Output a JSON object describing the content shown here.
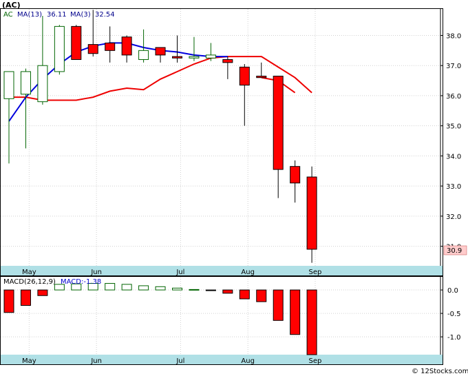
{
  "header": {
    "title": "(AC)",
    "legend_symbol": "AC",
    "ma13_label": "MA(13)",
    "ma13_value": "36.11",
    "ma3_label": "MA(3)",
    "ma3_value": "32.54",
    "macd_label": "MACD(26,12,9)",
    "macd_value_label": "MACD:-1.38"
  },
  "last_price_label": "30.9",
  "footer": {
    "credit": "© 12Stocks.com"
  },
  "colors": {
    "up": "#006400",
    "down": "#ff0000",
    "ma13": "#0000dd",
    "ma3": "#ee0000",
    "axis_band": "#b0e0e6",
    "price_tag": "#ffcccc"
  },
  "chart_data": [
    {
      "type": "candlestick",
      "x_ticks": [
        "May",
        "Jun",
        "Jul",
        "Aug",
        "Sep"
      ],
      "x_tick_index": [
        1.2,
        5.2,
        10.2,
        14.2,
        18.2
      ],
      "y_ticks": [
        31.0,
        32.0,
        33.0,
        34.0,
        35.0,
        36.0,
        37.0,
        38.0
      ],
      "y_tick_labels": [
        "31.0",
        "32.0",
        "33.0",
        "34.0",
        "35.0",
        "36.0",
        "37.0",
        "38.0"
      ],
      "ylim": [
        30.35,
        38.88
      ],
      "grid": true,
      "candles": [
        {
          "open": 35.9,
          "high": 36.5,
          "low": 33.75,
          "close": 36.8
        },
        {
          "open": 36.05,
          "high": 36.9,
          "low": 34.25,
          "close": 36.8
        },
        {
          "open": 35.8,
          "high": 38.65,
          "low": 35.7,
          "close": 37.0
        },
        {
          "open": 36.8,
          "high": 38.35,
          "low": 36.7,
          "close": 38.3
        },
        {
          "open": 38.3,
          "high": 38.35,
          "low": 37.2,
          "close": 37.2
        },
        {
          "open": 37.7,
          "high": 38.85,
          "low": 37.3,
          "close": 37.4
        },
        {
          "open": 37.75,
          "high": 38.3,
          "low": 37.1,
          "close": 37.5
        },
        {
          "open": 37.95,
          "high": 38.0,
          "low": 37.1,
          "close": 37.35
        },
        {
          "open": 37.2,
          "high": 38.2,
          "low": 37.1,
          "close": 37.5
        },
        {
          "open": 37.6,
          "high": 37.6,
          "low": 37.1,
          "close": 37.35
        },
        {
          "open": 37.3,
          "high": 38.0,
          "low": 37.1,
          "close": 37.25
        },
        {
          "open": 37.25,
          "high": 37.95,
          "low": 37.15,
          "close": 37.3
        },
        {
          "open": 37.25,
          "high": 37.75,
          "low": 37.15,
          "close": 37.35
        },
        {
          "open": 37.2,
          "high": 37.3,
          "low": 36.55,
          "close": 37.1
        },
        {
          "open": 36.95,
          "high": 37.05,
          "low": 35.0,
          "close": 36.35
        },
        {
          "open": 36.65,
          "high": 37.1,
          "low": 36.6,
          "close": 36.6
        },
        {
          "open": 36.65,
          "high": 36.65,
          "low": 32.6,
          "close": 33.55
        },
        {
          "open": 33.65,
          "high": 33.85,
          "low": 32.45,
          "close": 33.1
        },
        {
          "open": 33.3,
          "high": 33.65,
          "low": 30.45,
          "close": 30.9
        }
      ],
      "series": [
        {
          "name": "MA(13)",
          "values": [
            35.15,
            35.95,
            36.55,
            37.05,
            37.45,
            37.65,
            37.75,
            37.75,
            37.6,
            37.5,
            37.45,
            37.35,
            37.3,
            37.3,
            null,
            null,
            null,
            null,
            null
          ]
        },
        {
          "name": "MA(3)",
          "values": [
            35.95,
            35.95,
            35.85,
            35.85,
            35.85,
            35.95,
            36.15,
            36.25,
            36.2,
            36.55,
            36.8,
            37.05,
            37.25,
            37.3,
            37.3,
            37.3,
            36.95,
            36.6,
            36.1
          ]
        },
        {
          "name": "MA(3) late",
          "values": [
            null,
            null,
            null,
            null,
            null,
            null,
            null,
            null,
            null,
            null,
            null,
            null,
            null,
            null,
            null,
            36.6,
            36.5,
            36.1,
            null
          ]
        }
      ]
    },
    {
      "type": "bar",
      "title": "MACD(26,12,9)",
      "y_ticks": [
        0.0,
        -0.5,
        -1.0
      ],
      "y_tick_labels": [
        "0.0",
        "-0.5",
        "-1.0"
      ],
      "ylim": [
        -1.38,
        0.28
      ],
      "values": [
        -0.48,
        -0.33,
        -0.12,
        0.12,
        0.13,
        0.14,
        0.14,
        0.12,
        0.09,
        0.07,
        0.04,
        0.01,
        -0.01,
        -0.07,
        -0.19,
        -0.25,
        -0.65,
        -0.95,
        -1.38
      ]
    }
  ]
}
